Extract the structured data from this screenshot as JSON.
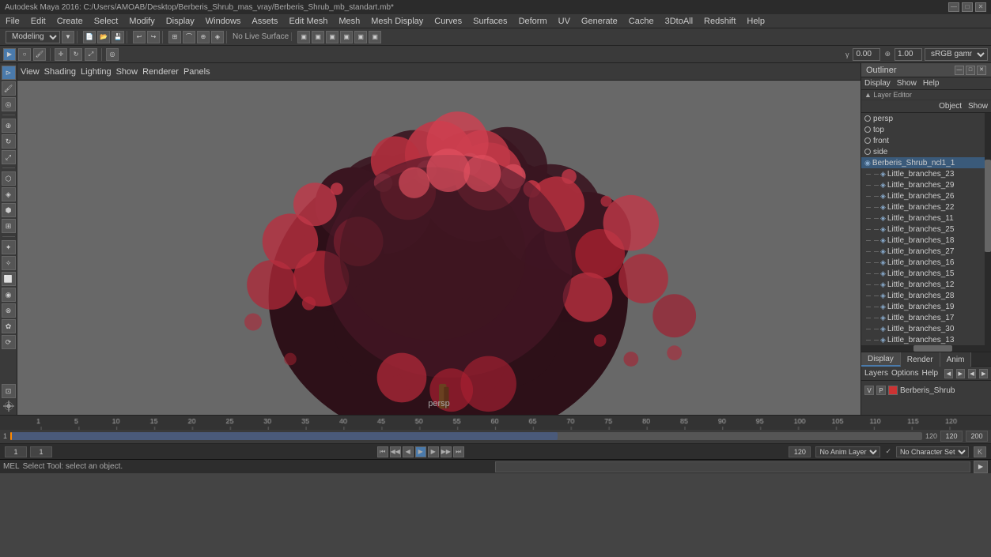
{
  "title_bar": {
    "title": "Autodesk Maya 2016: C:/Users/AMOAB/Desktop/Berberis_Shrub_mas_vray/Berberis_Shrub_mb_standart.mb*",
    "minimize": "—",
    "maximize": "□",
    "close": "✕"
  },
  "menu_bar": {
    "items": [
      "File",
      "Edit",
      "Create",
      "Select",
      "Modify",
      "Display",
      "Windows",
      "Assets",
      "Edit Mesh",
      "Mesh",
      "Mesh Display",
      "Curves",
      "Surfaces",
      "Deform",
      "UV",
      "Generate",
      "Cache",
      "3DtoAll",
      "Redshift",
      "Help"
    ]
  },
  "toolbar": {
    "workspace": "Modeling",
    "no_live_label": "No Live Surface"
  },
  "viewport_toolbar": {
    "items": [
      "View",
      "Shading",
      "Lighting",
      "Show",
      "Renderer",
      "Panels"
    ],
    "gamma_value": "0.00",
    "exposure_value": "1.00",
    "color_space": "sRGB gamma"
  },
  "outliner": {
    "title": "Outliner",
    "menu_items": [
      "Display",
      "Show",
      "Help"
    ],
    "layer_editor_label": "Layer Editor",
    "items": [
      {
        "name": "persp",
        "level": 0,
        "type": "circle"
      },
      {
        "name": "top",
        "level": 0,
        "type": "circle"
      },
      {
        "name": "front",
        "level": 0,
        "type": "circle"
      },
      {
        "name": "side",
        "level": 0,
        "type": "circle"
      },
      {
        "name": "Berberis_Shrub_ncl1_1",
        "level": 0,
        "type": "group",
        "selected": true
      },
      {
        "name": "Little_branches_23",
        "level": 1,
        "type": "mesh"
      },
      {
        "name": "Little_branches_29",
        "level": 1,
        "type": "mesh"
      },
      {
        "name": "Little_branches_26",
        "level": 1,
        "type": "mesh"
      },
      {
        "name": "Little_branches_22",
        "level": 1,
        "type": "mesh"
      },
      {
        "name": "Little_branches_11",
        "level": 1,
        "type": "mesh"
      },
      {
        "name": "Little_branches_25",
        "level": 1,
        "type": "mesh"
      },
      {
        "name": "Little_branches_18",
        "level": 1,
        "type": "mesh"
      },
      {
        "name": "Little_branches_27",
        "level": 1,
        "type": "mesh"
      },
      {
        "name": "Little_branches_16",
        "level": 1,
        "type": "mesh"
      },
      {
        "name": "Little_branches_15",
        "level": 1,
        "type": "mesh"
      },
      {
        "name": "Little_branches_12",
        "level": 1,
        "type": "mesh"
      },
      {
        "name": "Little_branches_28",
        "level": 1,
        "type": "mesh"
      },
      {
        "name": "Little_branches_19",
        "level": 1,
        "type": "mesh"
      },
      {
        "name": "Little_branches_17",
        "level": 1,
        "type": "mesh"
      },
      {
        "name": "Little_branches_30",
        "level": 1,
        "type": "mesh"
      },
      {
        "name": "Little_branches_13",
        "level": 1,
        "type": "mesh"
      }
    ]
  },
  "layer_editor": {
    "tabs": [
      "Display",
      "Render",
      "Anim"
    ],
    "active_tab": "Display",
    "toolbar_items": [
      "Layers",
      "Options",
      "Help"
    ],
    "layers": [
      {
        "v": "V",
        "p": "P",
        "color": "#cc3333",
        "name": "Berberis_Shrub"
      }
    ]
  },
  "timeline": {
    "start_frame": "1",
    "current_frame": "1",
    "end_frame": "120",
    "range_end": "200",
    "ticks": [
      "1",
      "5",
      "10",
      "15",
      "20",
      "25",
      "30",
      "35",
      "40",
      "45",
      "50",
      "55",
      "60",
      "65",
      "70",
      "75",
      "80",
      "85",
      "90",
      "95",
      "100",
      "105",
      "110",
      "115",
      "120"
    ]
  },
  "playback": {
    "controls": [
      "⏮",
      "⏮",
      "⏪",
      "▶",
      "⏩",
      "⏭",
      "⏭"
    ],
    "frame_value": "1",
    "anim_layer": "No Anim Layer",
    "char_set": "No Character Set"
  },
  "status_bar": {
    "mel_label": "MEL",
    "status_text": "Select Tool: select an object.",
    "frame_input": "1",
    "start_frame": "1",
    "end_frame": "120",
    "extra": "200"
  },
  "viewport": {
    "label": "persp",
    "background_color": "#686868"
  },
  "colors": {
    "bg": "#444444",
    "panel_bg": "#3a3a3a",
    "dark_bg": "#2d2d2d",
    "accent": "#4a7aab",
    "shrub_dark": "#3d1520",
    "shrub_bright": "#c0384a"
  }
}
